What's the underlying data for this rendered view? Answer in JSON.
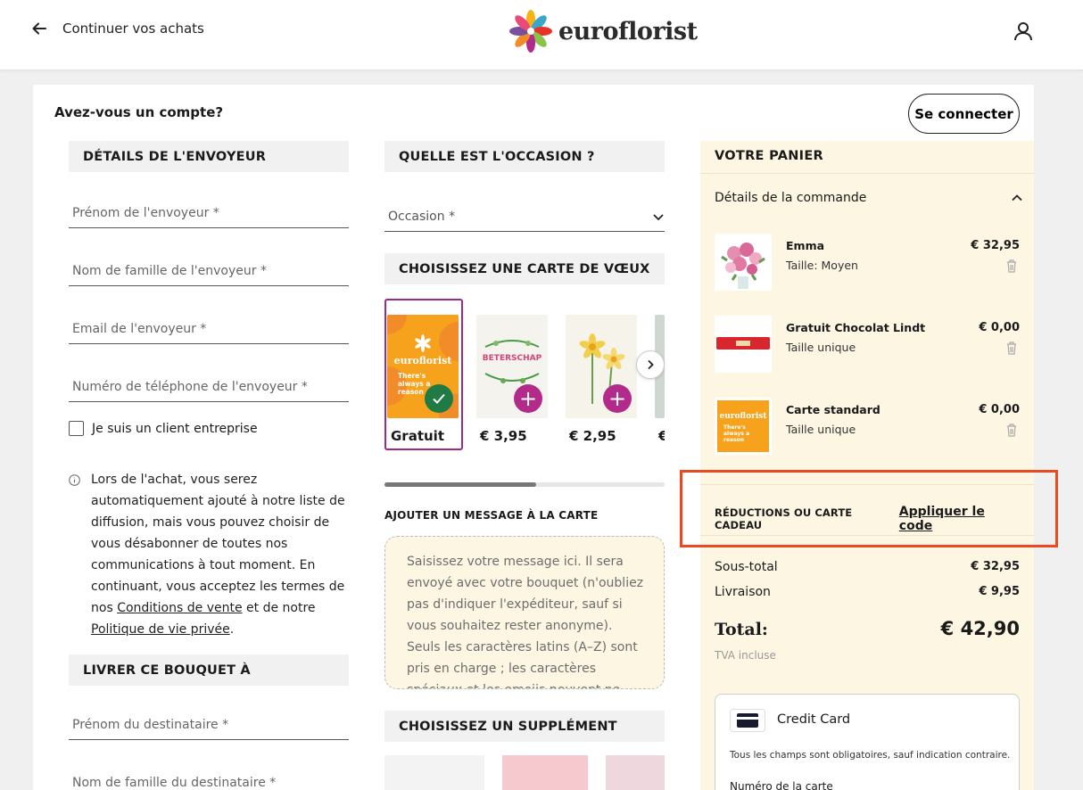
{
  "header": {
    "back_label": "Continuer vos achats",
    "logo_text": "euroflorist"
  },
  "account": {
    "question": "Avez-vous un compte?",
    "login_label": "Se connecter"
  },
  "sender": {
    "heading": "DÉTAILS DE L'ENVOYEUR",
    "first_name_placeholder": "Prénom de l'envoyeur *",
    "last_name_placeholder": "Nom de famille de l'envoyeur *",
    "email_placeholder": "Email de l'envoyeur *",
    "phone_placeholder": "Numéro de téléphone de l'envoyeur *",
    "business_label": "Je suis un client entreprise",
    "info_text_1": "Lors de l'achat, vous serez automatiquement ajouté à notre liste de diffusion, mais vous pouvez choisir de vous désabonner de toutes nos communications à tout moment. En continuant, vous acceptez les termes de nos ",
    "terms_link": "Conditions de vente",
    "info_text_2": " et de notre ",
    "privacy_link": "Politique de vie privée",
    "info_text_3": "."
  },
  "recipient": {
    "heading": "LIVRER CE BOUQUET À",
    "first_name_placeholder": "Prénom du destinataire *",
    "last_name_placeholder": "Nom de famille du destinataire *"
  },
  "occasion": {
    "heading": "QUELLE EST L'OCCASION ?",
    "select_placeholder": "Occasion *"
  },
  "greeting_cards": {
    "heading": "CHOISISSEZ UNE CARTE DE VŒUX",
    "cards": [
      {
        "price": "Gratuit",
        "brand": "euroflorist",
        "text": "There's always a reason",
        "selected": true
      },
      {
        "price": "€ 3,95",
        "text": "BETERSCHAP",
        "selected": false
      },
      {
        "price": "€ 2,95",
        "selected": false
      },
      {
        "price": "€"
      }
    ],
    "scroll_position": 0.54
  },
  "message": {
    "label": "AJOUTER UN MESSAGE À LA CARTE",
    "placeholder": "Saisissez votre message ici. Il sera envoyé avec votre bouquet (n'oubliez pas d'indiquer l'expéditeur, sauf si vous souhaitez rester anonyme). Seuls les caractères latins (A–Z) sont pris en charge ; les caractères spéciaux et les emojis peuvent ne pas s'afficher correctement."
  },
  "supplement": {
    "heading": "CHOISISSEZ UN SUPPLÉMENT"
  },
  "cart": {
    "heading": "VOTRE PANIER",
    "details_label": "Détails de la commande",
    "items": [
      {
        "name": "Emma",
        "variant": "Taille: Moyen",
        "price": "€ 32,95"
      },
      {
        "name": "Gratuit Chocolat Lindt",
        "variant": "Taille unique",
        "price": "€ 0,00"
      },
      {
        "name": "Carte standard",
        "variant": "Taille unique",
        "price": "€ 0,00"
      }
    ],
    "promo_label": "RÉDUCTIONS OU CARTE CADEAU",
    "promo_link": "Appliquer le code",
    "subtotal_label": "Sous-total",
    "subtotal_value": "€ 32,95",
    "delivery_label": "Livraison",
    "delivery_value": "€ 9,95",
    "total_label": "Total:",
    "total_value": "€ 42,90",
    "vat_label": "TVA incluse"
  },
  "payment": {
    "method_label": "Credit Card",
    "note": "Tous les champs sont obligatoires, sauf indication contraire.",
    "card_number_label": "Numéro de la carte"
  },
  "colors": {
    "accent_purple": "#9a2a86",
    "plus_magenta": "#b22a8a",
    "check_green": "#1f7a43",
    "cart_bg": "#fdf6e3",
    "highlight_orange": "#e94a1f"
  }
}
